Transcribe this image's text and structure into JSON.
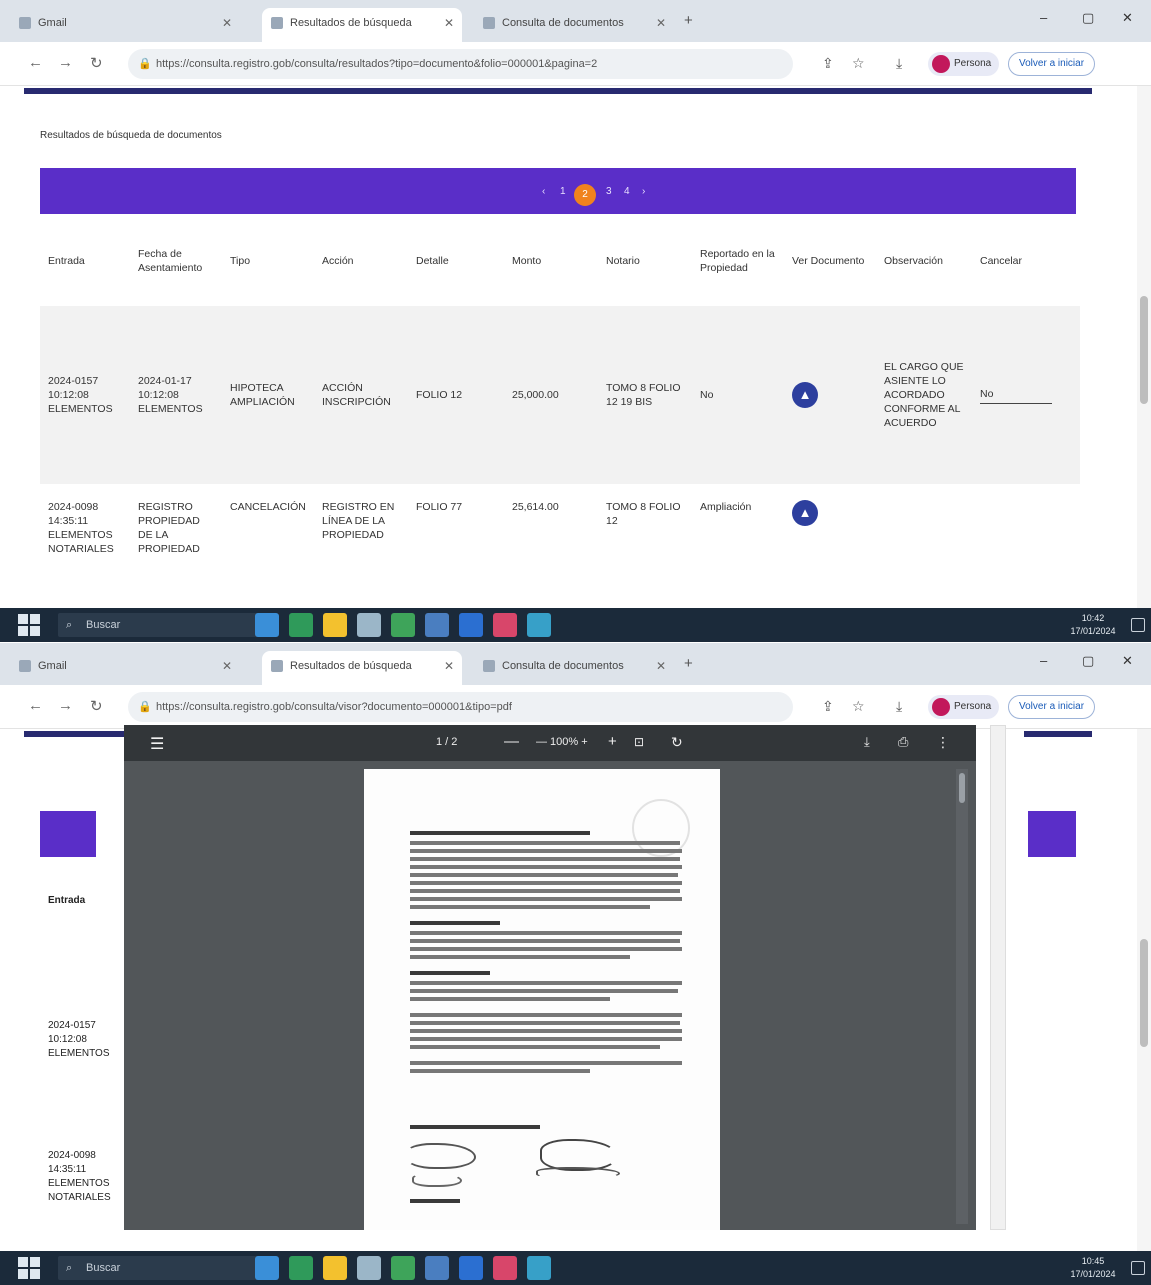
{
  "browser": {
    "tabs": [
      {
        "label": "Gmail",
        "active": false
      },
      {
        "label": "Resultados de búsqueda",
        "active": true
      },
      {
        "label": "Consulta de documentos",
        "active": false
      }
    ],
    "new_tab": "+",
    "window_controls": {
      "minimize": "–",
      "maximize": "▢",
      "close": "✕"
    },
    "nav": {
      "back": "←",
      "forward": "→",
      "reload": "↻"
    },
    "address": "https://consulta.registro.gob/consulta/resultados?tipo=documento&folio=000001&pagina=2",
    "address_shot2": "https://consulta.registro.gob/consulta/visor?documento=000001&tipo=pdf",
    "profile_label": "Persona",
    "relaunch_label": "Volver a iniciar"
  },
  "page": {
    "title": "Resultados de búsqueda de documentos",
    "pager": {
      "prev": "‹",
      "pages": [
        "1",
        "2",
        "3",
        "4"
      ],
      "current": "2",
      "next": "›"
    },
    "columns": [
      "Entrada",
      "Fecha de Asentamiento",
      "Tipo",
      "Acción",
      "Detalle",
      "Monto",
      "Notario",
      "Reportado en la Propiedad",
      "Ver Documento",
      "Observación",
      "Cancelar"
    ],
    "rows": [
      {
        "entrada": "2024-0157 10:12:08 ELEMENTOS",
        "fecha": "2024-01-17 10:12:08 ELEMENTOS",
        "tipo": "HIPOTECA AMPLIACIÓN",
        "accion": "ACCIÓN INSCRIPCIÓN",
        "detalle": "FOLIO 12",
        "monto": "25,000.00",
        "notario": "TOMO 8 FOLIO 12 19 BIS",
        "reportado": "No",
        "ver_documento": "▲",
        "observacion": "EL CARGO QUE ASIENTE LO ACORDADO CONFORME AL ACUERDO",
        "cancelar": "No"
      },
      {
        "entrada": "2024-0098 14:35:11 ELEMENTOS NOTARIALES",
        "fecha": "REGISTRO PROPIEDAD DE LA PROPIEDAD",
        "tipo": "CANCELACIÓN",
        "accion": "REGISTRO EN LÍNEA DE LA PROPIEDAD",
        "detalle": "FOLIO 77",
        "monto": "25,614.00",
        "notario": "TOMO 8 FOLIO 12",
        "reportado": "Ampliación",
        "ver_documento": "▲",
        "observacion": "",
        "cancelar": ""
      }
    ]
  },
  "pdf_viewer": {
    "menu": "☰",
    "page_info": "1 / 2",
    "zoom": "— 100% +",
    "zoom_out": "—",
    "zoom_in": "+",
    "fit": "⊡",
    "rotate": "↻",
    "download": "⤓",
    "print": "⎙",
    "more": "⋮"
  },
  "taskbar": {
    "search_placeholder": "Buscar",
    "time": "10:42",
    "date": "17/01/2024",
    "time2": "10:45",
    "date2": "17/01/2024"
  },
  "colors": {
    "accent_purple": "#5a2ec8",
    "navy_line": "#282a70",
    "pager_current": "#f0831e",
    "doc_icon": "#2d3f9e",
    "taskbar": "#1b2a3a"
  }
}
